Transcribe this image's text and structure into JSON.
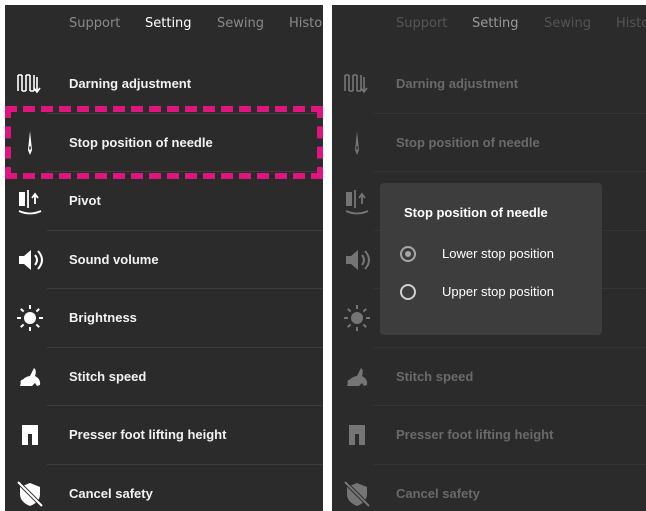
{
  "tabs": [
    "Support",
    "Setting",
    "Sewing",
    "History"
  ],
  "active_tab": "Setting",
  "settings": [
    {
      "label": "Darning adjustment",
      "icon": "darning-icon"
    },
    {
      "label": "Stop position of needle",
      "icon": "needle-icon"
    },
    {
      "label": "Pivot",
      "icon": "pivot-icon"
    },
    {
      "label": "Sound volume",
      "icon": "speaker-icon"
    },
    {
      "label": "Brightness",
      "icon": "sun-icon"
    },
    {
      "label": "Stitch speed",
      "icon": "rabbit-icon"
    },
    {
      "label": "Presser foot lifting height",
      "icon": "presser-foot-icon"
    },
    {
      "label": "Cancel safety",
      "icon": "shield-off-icon"
    }
  ],
  "highlight": {
    "target": "Stop position of needle",
    "color": "#e0147f"
  },
  "dialog": {
    "title": "Stop position of needle",
    "options": [
      {
        "label": "Lower stop position",
        "selected": true
      },
      {
        "label": "Upper stop position",
        "selected": false
      }
    ]
  }
}
